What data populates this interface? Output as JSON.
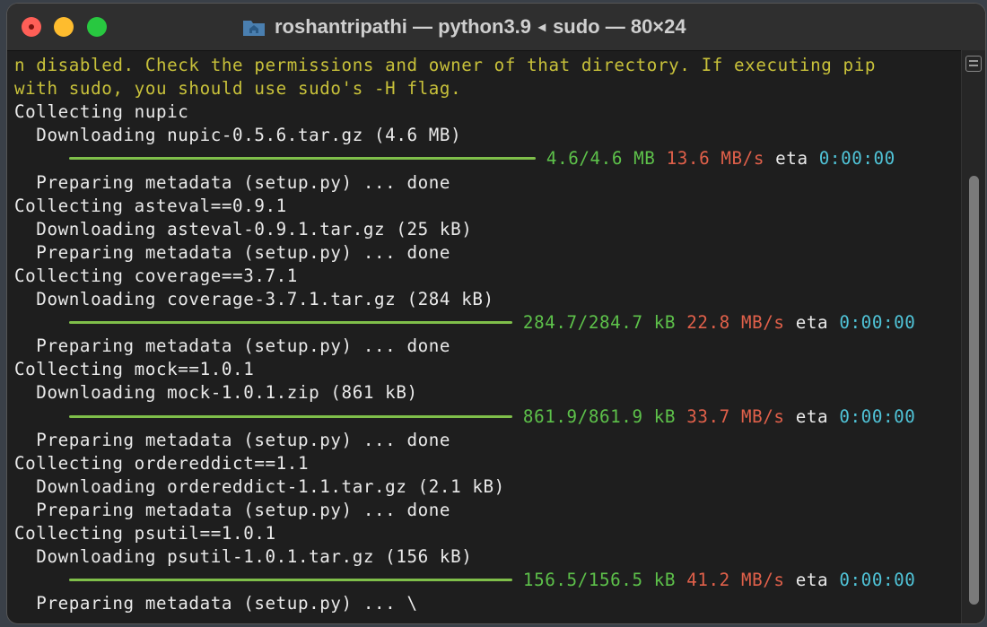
{
  "window": {
    "title": "roshantripathi — python3.9",
    "title_tab": "sudo — 80×24"
  },
  "terminal": {
    "lines": [
      {
        "type": "text",
        "class": "warn",
        "text": "n disabled. Check the permissions and owner of that directory. If executing pip"
      },
      {
        "type": "text",
        "class": "warn",
        "text": "with sudo, you should use sudo's -H flag."
      },
      {
        "type": "text",
        "text": "Collecting nupic"
      },
      {
        "type": "text",
        "text": "  Downloading nupic-0.5.6.tar.gz (4.6 MB)"
      },
      {
        "type": "bar",
        "indent": 5,
        "bar_chars": 40,
        "size": "4.6/4.6 MB",
        "speed": "13.6 MB/s",
        "eta_label": "eta",
        "eta": "0:00:00"
      },
      {
        "type": "text",
        "text": "  Preparing metadata (setup.py) ... done"
      },
      {
        "type": "text",
        "text": "Collecting asteval==0.9.1"
      },
      {
        "type": "text",
        "text": "  Downloading asteval-0.9.1.tar.gz (25 kB)"
      },
      {
        "type": "text",
        "text": "  Preparing metadata (setup.py) ... done"
      },
      {
        "type": "text",
        "text": "Collecting coverage==3.7.1"
      },
      {
        "type": "text",
        "text": "  Downloading coverage-3.7.1.tar.gz (284 kB)"
      },
      {
        "type": "bar",
        "indent": 5,
        "bar_chars": 38,
        "size": "284.7/284.7 kB",
        "speed": "22.8 MB/s",
        "eta_label": "eta",
        "eta": "0:00:00"
      },
      {
        "type": "text",
        "text": "  Preparing metadata (setup.py) ... done"
      },
      {
        "type": "text",
        "text": "Collecting mock==1.0.1"
      },
      {
        "type": "text",
        "text": "  Downloading mock-1.0.1.zip (861 kB)"
      },
      {
        "type": "bar",
        "indent": 5,
        "bar_chars": 38,
        "size": "861.9/861.9 kB",
        "speed": "33.7 MB/s",
        "eta_label": "eta",
        "eta": "0:00:00"
      },
      {
        "type": "text",
        "text": "  Preparing metadata (setup.py) ... done"
      },
      {
        "type": "text",
        "text": "Collecting ordereddict==1.1"
      },
      {
        "type": "text",
        "text": "  Downloading ordereddict-1.1.tar.gz (2.1 kB)"
      },
      {
        "type": "text",
        "text": "  Preparing metadata (setup.py) ... done"
      },
      {
        "type": "text",
        "text": "Collecting psutil==1.0.1"
      },
      {
        "type": "text",
        "text": "  Downloading psutil-1.0.1.tar.gz (156 kB)"
      },
      {
        "type": "bar",
        "indent": 5,
        "bar_chars": 38,
        "size": "156.5/156.5 kB",
        "speed": "41.2 MB/s",
        "eta_label": "eta",
        "eta": "0:00:00"
      },
      {
        "type": "text",
        "text": "  Preparing metadata (setup.py) ... \\"
      }
    ]
  },
  "colors": {
    "warning_text": "#c8c13a",
    "progress_bar": "#7fbf4a",
    "size_text": "#5dc14a",
    "speed_text": "#e0604a",
    "eta_value": "#50c4d8"
  }
}
